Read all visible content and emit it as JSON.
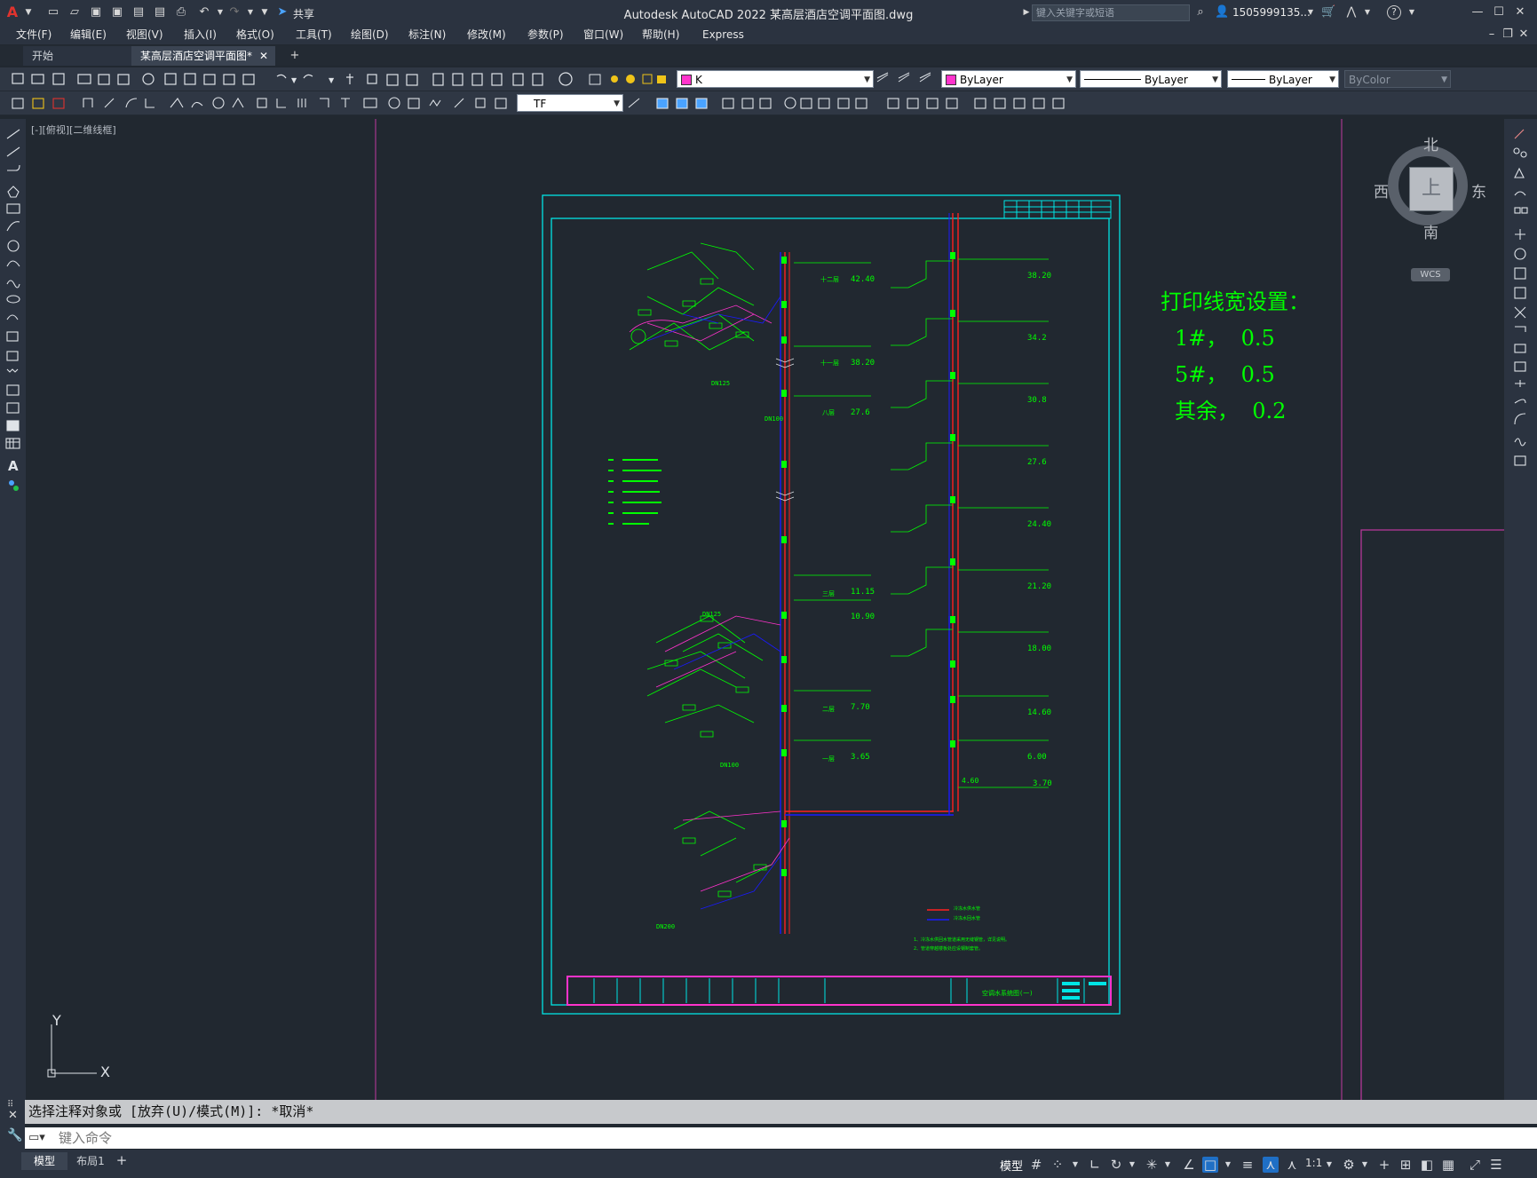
{
  "app": {
    "title": "Autodesk AutoCAD 2022    某高层酒店空调平面图.dwg",
    "logo": "A",
    "share_label": "共享",
    "search_placeholder": "键入关键字或短语",
    "user": "1505999135...",
    "help": "?"
  },
  "menu": [
    "文件(F)",
    "编辑(E)",
    "视图(V)",
    "插入(I)",
    "格式(O)",
    "工具(T)",
    "绘图(D)",
    "标注(N)",
    "修改(M)",
    "参数(P)",
    "窗口(W)",
    "帮助(H)",
    "Express"
  ],
  "tabs": [
    {
      "label": "开始",
      "active": false
    },
    {
      "label": "某高层酒店空调平面图*",
      "active": true
    }
  ],
  "properties": {
    "layer": "K",
    "color": "ByLayer",
    "linetype": "ByLayer",
    "lineweight": "ByLayer",
    "plotstyle": "ByColor",
    "textstyle": "TF"
  },
  "viewport_label": "[-][俯视][二维线框]",
  "viewcube": {
    "north": "北",
    "south": "南",
    "east": "东",
    "west": "西",
    "top": "上",
    "wcs": "WCS"
  },
  "ucs": {
    "x": "X",
    "y": "Y"
  },
  "note": {
    "title": "打印线宽设置：",
    "lines": [
      "1#，  0.5",
      "5#，  0.5",
      "其余，  0.2"
    ]
  },
  "drawing": {
    "title_block": "空调水系统图(一)",
    "left_elevations": [
      "42.40",
      "38.20",
      "27.6",
      "11.15",
      "10.90",
      "7.70",
      "3.65"
    ],
    "right_elevations": [
      "38.20",
      "34.2",
      "30.8",
      "27.6",
      "24.40",
      "21.20",
      "18.00",
      "14.60",
      "6.00",
      "3.70"
    ],
    "floor_tags": [
      "十二层",
      "十一层",
      "八层",
      "三层",
      "二层",
      "一层"
    ],
    "pipe_labels": [
      "DN125",
      "DN100",
      "DN125",
      "DN100",
      "DN200"
    ],
    "bottom_elev": "4.60",
    "legend": [
      "冷冻水供水管",
      "冷冻水回水管"
    ],
    "notes": [
      "1、冷冻水供回水管道采用无缝钢管，详见说明。",
      "2、管道穿越楼板处应设钢制套管。"
    ]
  },
  "command": {
    "history": "选择注释对象或 [放弃(U)/模式(M)]: *取消*",
    "placeholder": "键入命令"
  },
  "layout_tabs": [
    "模型",
    "布局1"
  ],
  "status": {
    "model": "模型",
    "scale": "1:1"
  }
}
